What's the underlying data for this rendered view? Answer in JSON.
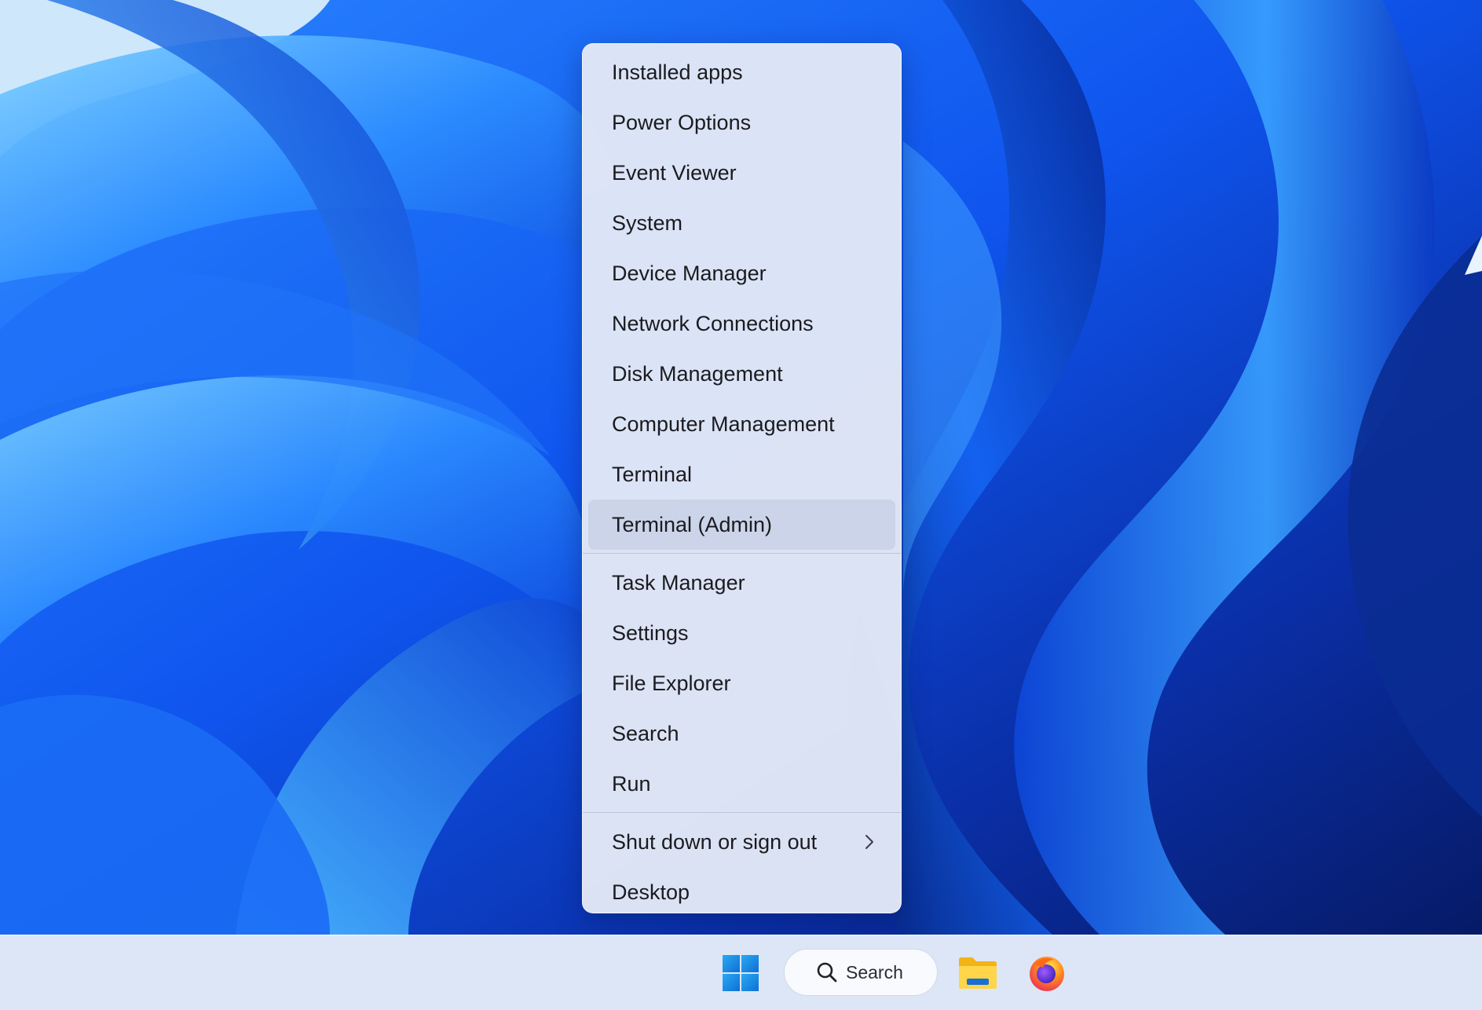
{
  "context_menu": {
    "groups": [
      {
        "items": [
          {
            "label": "Installed apps"
          },
          {
            "label": "Power Options"
          },
          {
            "label": "Event Viewer"
          },
          {
            "label": "System"
          },
          {
            "label": "Device Manager"
          },
          {
            "label": "Network Connections"
          },
          {
            "label": "Disk Management"
          },
          {
            "label": "Computer Management"
          },
          {
            "label": "Terminal"
          },
          {
            "label": "Terminal (Admin)",
            "state": "hovered"
          }
        ]
      },
      {
        "items": [
          {
            "label": "Task Manager"
          },
          {
            "label": "Settings"
          },
          {
            "label": "File Explorer"
          },
          {
            "label": "Search"
          },
          {
            "label": "Run"
          }
        ]
      },
      {
        "items": [
          {
            "label": "Shut down or sign out",
            "has_submenu": true,
            "submenu_icon": "chevron-right-icon"
          },
          {
            "label": "Desktop"
          }
        ]
      }
    ]
  },
  "taskbar": {
    "start_icon": "windows-logo-icon",
    "search": {
      "label": "Search",
      "icon": "search-icon"
    },
    "pinned_apps": [
      {
        "name": "File Explorer",
        "icon": "folder-icon"
      },
      {
        "name": "Firefox",
        "icon": "firefox-icon"
      }
    ]
  },
  "colors": {
    "wallpaper_accent": "#1565ff",
    "menu_background": "#e2e8f6",
    "taskbar_background": "#dde6f6",
    "windows_logo": "#1e8fe8"
  }
}
